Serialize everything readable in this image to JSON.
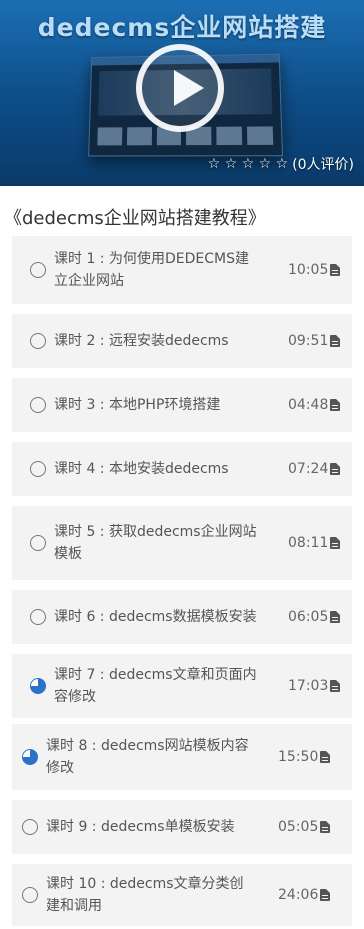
{
  "video": {
    "banner_text": "dedecms企业网站搭建",
    "stars": "☆ ☆ ☆ ☆ ☆",
    "rating_text": "(0人评价)"
  },
  "course": {
    "title": "《dedecms企业网站搭建教程》"
  },
  "colors": {
    "accent": "#2a73c9",
    "hero": "#0d4c86",
    "item_bg": "#f3f3f3"
  },
  "lessons": [
    {
      "label": "课时 1 : 为何使用DEDECMS建\n立企业网站",
      "time": "10:05",
      "status": "not-started"
    },
    {
      "label": "课时 2 : 远程安装dedecms",
      "time": "09:51",
      "status": "not-started"
    },
    {
      "label": "课时 3 : 本地PHP环境搭建",
      "time": "04:48",
      "status": "not-started"
    },
    {
      "label": "课时 4 : 本地安装dedecms",
      "time": "07:24",
      "status": "not-started"
    },
    {
      "label": "课时 5 : 获取dedecms企业网站\n模板",
      "time": "08:11",
      "status": "not-started"
    },
    {
      "label": "课时 6 : dedecms数据模板安装",
      "time": "06:05",
      "status": "not-started"
    },
    {
      "label": "课时 7 : dedecms文章和页面内\n容修改",
      "time": "17:03",
      "status": "in-progress"
    },
    {
      "label": "课时 8 : dedecms网站模板内容\n修改",
      "time": "15:50",
      "status": "in-progress"
    },
    {
      "label": "课时 9 : dedecms单模板安装",
      "time": "05:05",
      "status": "not-started"
    },
    {
      "label": "课时 10 : dedecms文章分类创\n建和调用",
      "time": "24:06",
      "status": "not-started"
    }
  ]
}
